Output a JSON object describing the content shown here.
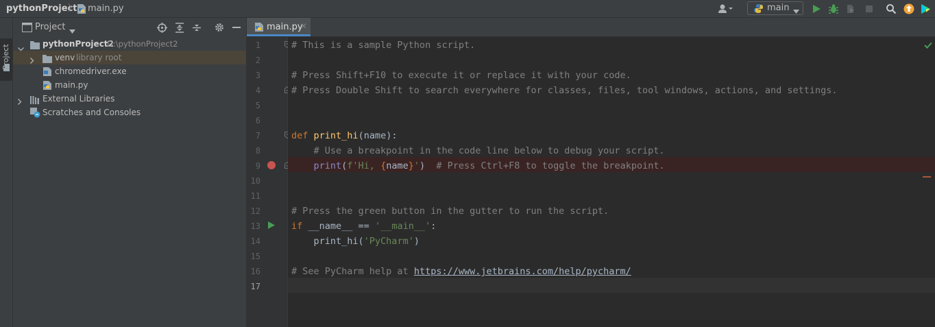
{
  "breadcrumb": {
    "project": "pythonProject2",
    "file": "main.py"
  },
  "toolbar": {
    "run_config": "main"
  },
  "sidebar_strip": {
    "project_tab": "Project"
  },
  "project_panel": {
    "title": "Project",
    "tree": [
      {
        "label": "pythonProject2",
        "hint": "D:\\pythonProject2"
      },
      {
        "label": "venv",
        "hint": "library root"
      },
      {
        "label": "chromedriver.exe"
      },
      {
        "label": "main.py"
      },
      {
        "label": "External Libraries"
      },
      {
        "label": "Scratches and Consoles"
      }
    ]
  },
  "editor": {
    "tab_label": "main.py",
    "line_numbers": [
      "1",
      "2",
      "3",
      "4",
      "5",
      "6",
      "7",
      "8",
      "9",
      "10",
      "11",
      "12",
      "13",
      "14",
      "15",
      "16",
      "17"
    ],
    "lines": {
      "l1": "# This is a sample Python script.",
      "l3": "# Press Shift+F10 to execute it or replace it with your code.",
      "l4": "# Press Double Shift to search everywhere for classes, files, tool windows, actions, and settings.",
      "l7_kw": "def",
      "l7_fn": "print_hi",
      "l7_rest": "(name):",
      "l8": "    # Use a breakpoint in the code line below to debug your script.",
      "l9_fn": "print",
      "l9_open": "(",
      "l9_str1": "f'Hi, ",
      "l9_brace1": "{",
      "l9_name": "name",
      "l9_brace2": "}",
      "l9_str2": "'",
      "l9_close": ")",
      "l9_cmt": "# Press Ctrl+F8 to toggle the breakpoint.",
      "l12": "# Press the green button in the gutter to run the script.",
      "l13_kw": "if",
      "l13_mid": " __name__ == ",
      "l13_str": "'__main__'",
      "l13_end": ":",
      "l14_call": "print_hi(",
      "l14_str": "'PyCharm'",
      "l14_end": ")",
      "l16_cmt": "# See PyCharm help at ",
      "l16_link": "https://www.jetbrains.com/help/pycharm/"
    }
  },
  "colors": {
    "background": "#2b2b2b",
    "keyword": "#cc7832",
    "function": "#ffc66d",
    "string": "#6a8759",
    "comment": "#808080",
    "breakpoint": "#c75450",
    "run": "#499c54"
  }
}
